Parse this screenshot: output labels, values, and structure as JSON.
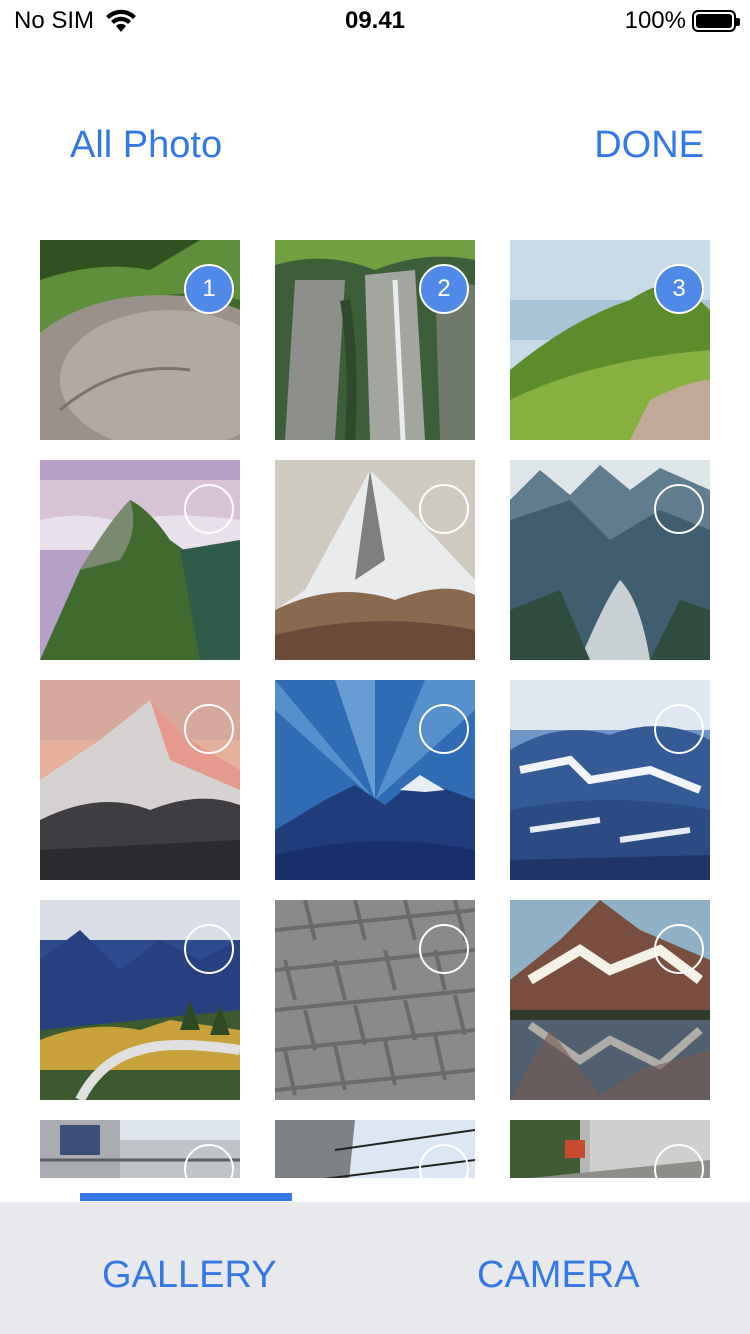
{
  "status_bar": {
    "carrier": "No SIM",
    "time": "09.41",
    "battery": "100%",
    "icons": [
      "wifi-icon",
      "battery-icon"
    ]
  },
  "header": {
    "title": "All Photo",
    "done_label": "DONE"
  },
  "photos": [
    {
      "scene": "grassy-rock",
      "selected": true,
      "order": "1"
    },
    {
      "scene": "cliff-waterfall",
      "selected": true,
      "order": "2"
    },
    {
      "scene": "green-ridge",
      "selected": true,
      "order": "3"
    },
    {
      "scene": "hill-above-clouds",
      "selected": false,
      "order": ""
    },
    {
      "scene": "matterhorn",
      "selected": false,
      "order": ""
    },
    {
      "scene": "glacier-valley",
      "selected": false,
      "order": ""
    },
    {
      "scene": "pink-peak",
      "selected": false,
      "order": ""
    },
    {
      "scene": "blue-sky-rays",
      "selected": false,
      "order": ""
    },
    {
      "scene": "snowy-blue-range",
      "selected": false,
      "order": ""
    },
    {
      "scene": "autumn-road",
      "selected": false,
      "order": ""
    },
    {
      "scene": "paving-stones",
      "selected": false,
      "order": ""
    },
    {
      "scene": "lake-reflection",
      "selected": false,
      "order": ""
    },
    {
      "scene": "building-corner",
      "selected": false,
      "order": ""
    },
    {
      "scene": "street-wires",
      "selected": false,
      "order": ""
    },
    {
      "scene": "garden-wall",
      "selected": false,
      "order": ""
    }
  ],
  "tabs": {
    "gallery": "GALLERY",
    "camera": "CAMERA",
    "active": "gallery"
  },
  "colors": {
    "accent": "#3478e6",
    "selected_badge": "#4f8ae8",
    "bottom_bar": "#e8e9ed"
  }
}
